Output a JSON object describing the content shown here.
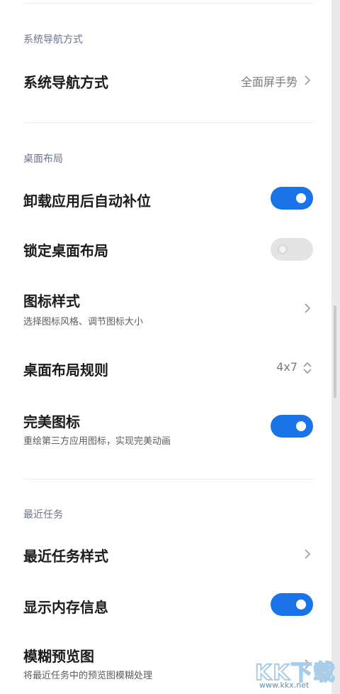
{
  "sections": [
    {
      "header": "系统导航方式"
    },
    {
      "header": "桌面布局"
    },
    {
      "header": "最近任务"
    }
  ],
  "rows": {
    "nav_mode": {
      "title": "系统导航方式",
      "value": "全面屏手势"
    },
    "auto_fill": {
      "title": "卸载应用后自动补位",
      "toggle": true
    },
    "lock_layout": {
      "title": "锁定桌面布局",
      "toggle": false
    },
    "icon_style": {
      "title": "图标样式",
      "subtitle": "选择图标风格、调节图标大小"
    },
    "layout_rule": {
      "title": "桌面布局规则",
      "value": "4x7"
    },
    "perfect_icons": {
      "title": "完美图标",
      "subtitle": "重绘第三方应用图标，实现完美动画",
      "toggle": true
    },
    "recent_style": {
      "title": "最近任务样式"
    },
    "memory_info": {
      "title": "显示内存信息",
      "toggle": true
    },
    "blur_preview": {
      "title": "模糊预览图",
      "subtitle": "将最近任务中的预览图模糊处理"
    }
  },
  "icons": {
    "chevron": "chevron-right-icon",
    "updown": "up-down-arrows-icon"
  },
  "colors": {
    "toggle_on": "#1b73e8",
    "toggle_off": "#e4e4e4",
    "section_header": "#6d7486"
  },
  "watermark": {
    "logo": "KK下载",
    "url": "www.kkx.net"
  }
}
